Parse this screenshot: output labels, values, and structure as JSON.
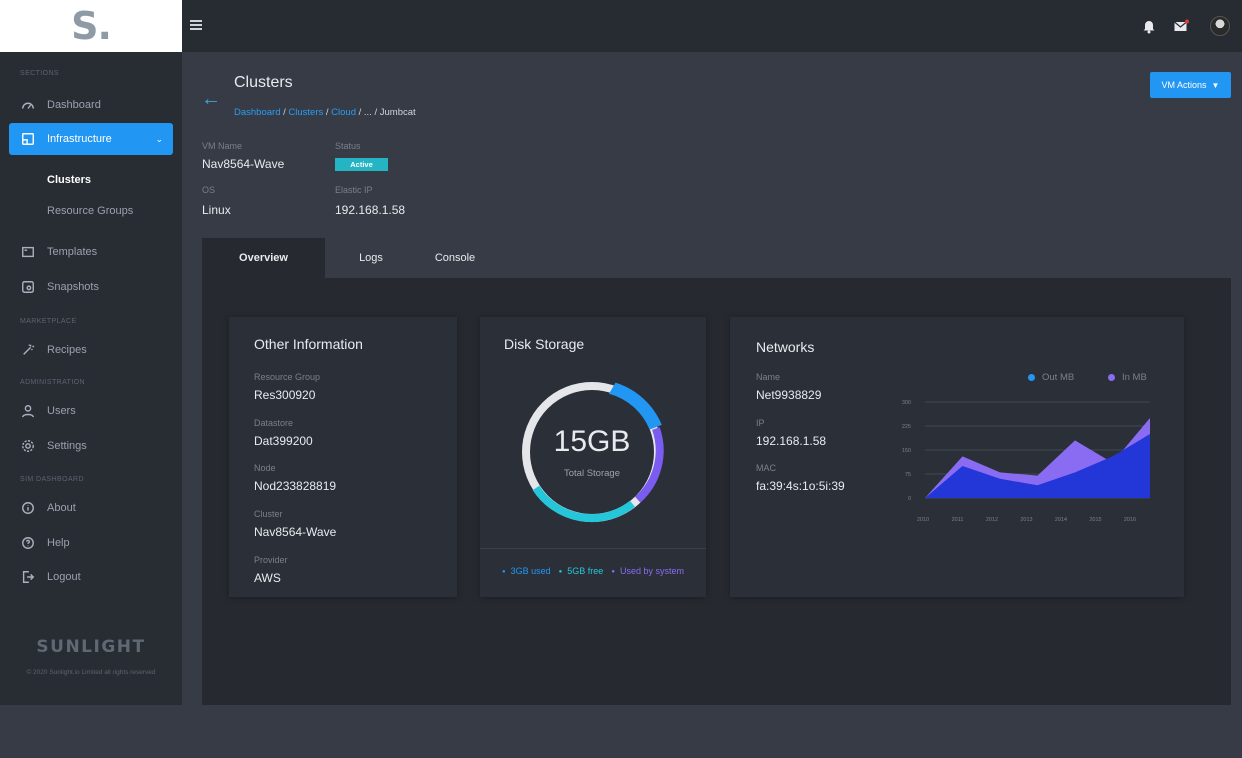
{
  "app": {
    "logo_text": "S.",
    "brand": "SUNLIGHT",
    "copyright": "© 2020 Sunlight.io Limited all rights reserved"
  },
  "sidebar": {
    "sections": [
      "SECTIONS",
      "MARKETPLACE",
      "ADMINISTRATION",
      "SIM DASHBOARD"
    ],
    "items": [
      {
        "label": "Dashboard",
        "icon": "gauge-icon"
      },
      {
        "label": "Infrastructure",
        "icon": "monitor-icon"
      },
      {
        "label": "Templates",
        "icon": "template-icon"
      },
      {
        "label": "Snapshots",
        "icon": "snapshot-icon"
      },
      {
        "label": "Recipes",
        "icon": "magic-wand-icon"
      },
      {
        "label": "Users",
        "icon": "user-icon"
      },
      {
        "label": "Settings",
        "icon": "gear-icon"
      },
      {
        "label": "About",
        "icon": "info-icon"
      },
      {
        "label": "Help",
        "icon": "help-icon"
      },
      {
        "label": "Logout",
        "icon": "logout-icon"
      }
    ],
    "sub_items": [
      "Clusters",
      "Resource Groups"
    ]
  },
  "header": {
    "title": "Clusters",
    "breadcrumb": {
      "links": [
        "Dashboard",
        "Clusters",
        "Cloud",
        "..."
      ],
      "current": "Jumbcat"
    },
    "vm_actions_label": "VM Actions"
  },
  "vm_info": {
    "vm_name_label": "VM Name",
    "vm_name": "Nav8564-Wave",
    "status_label": "Status",
    "status": "Active",
    "os_label": "OS",
    "os": "Linux",
    "elastic_ip_label": "Elastic IP",
    "elastic_ip": "192.168.1.58"
  },
  "tabs": [
    "Overview",
    "Logs",
    "Console"
  ],
  "other_information": {
    "title": "Other Information",
    "fields": [
      {
        "label": "Resource Group",
        "value": "Res300920"
      },
      {
        "label": "Datastore",
        "value": "Dat399200"
      },
      {
        "label": "Node",
        "value": "Nod233828819"
      },
      {
        "label": "Cluster",
        "value": "Nav8564-Wave"
      },
      {
        "label": "Provider",
        "value": "AWS"
      }
    ]
  },
  "disk_storage": {
    "title": "Disk Storage",
    "total": "15GB",
    "total_label": "Total Storage",
    "legend": [
      {
        "label": "3GB used",
        "color": "#2196f3"
      },
      {
        "label": "5GB free",
        "color": "#26c6da"
      },
      {
        "label": "Used by system",
        "color": "#7b5cf0"
      }
    ]
  },
  "networks": {
    "title": "Networks",
    "fields": [
      {
        "label": "Name",
        "value": "Net9938829"
      },
      {
        "label": "IP",
        "value": "192.168.1.58"
      },
      {
        "label": "MAC",
        "value": "fa:39:4s:1o:5i:39"
      }
    ]
  },
  "colors": {
    "accent": "#2196f3",
    "active_badge": "#24b4c4",
    "out_series": "#2336d8",
    "in_series": "#8a6cf2"
  },
  "chart_data": {
    "type": "area",
    "x": [
      "2010",
      "2011",
      "2012",
      "2013",
      "2014",
      "2015",
      "2016"
    ],
    "y_ticks": [
      "0",
      "75",
      "150",
      "225",
      "300"
    ],
    "ylim": [
      0,
      300
    ],
    "legend_placement": "top-right",
    "grid": true,
    "series": [
      {
        "name": "Out MB",
        "color": "#2196f3",
        "values": [
          0,
          100,
          60,
          40,
          80,
          130,
          200
        ]
      },
      {
        "name": "In MB",
        "color": "#8a6cf2",
        "values": [
          0,
          130,
          80,
          70,
          180,
          110,
          250
        ]
      }
    ]
  }
}
